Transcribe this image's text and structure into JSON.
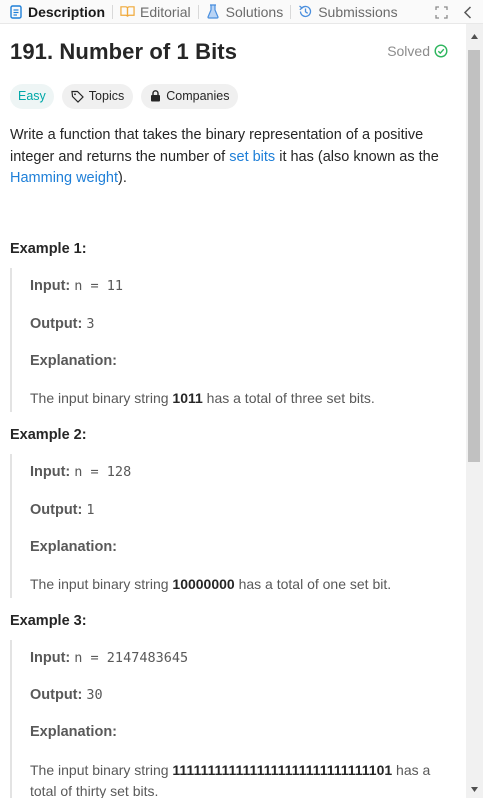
{
  "tabs": [
    {
      "label": "Description",
      "icon": "description-icon"
    },
    {
      "label": "Editorial",
      "icon": "book-icon"
    },
    {
      "label": "Solutions",
      "icon": "flask-icon"
    },
    {
      "label": "Submissions",
      "icon": "history-icon"
    }
  ],
  "problem": {
    "title": "191. Number of 1 Bits",
    "status": "Solved",
    "difficulty": "Easy",
    "topics_label": "Topics",
    "companies_label": "Companies",
    "desc_part1": "Write a function that takes the binary representation of a positive integer and returns the number of ",
    "desc_link1": "set bits",
    "desc_part2": " it has (also known as the ",
    "desc_link2": "Hamming weight",
    "desc_part3": ")."
  },
  "labels": {
    "input": "Input:",
    "output": "Output:",
    "explanation": "Explanation:"
  },
  "examples": [
    {
      "title": "Example 1:",
      "input": "n = 11",
      "output": "3",
      "exp_pre": "The input binary string ",
      "exp_bold": "1011",
      "exp_post": " has a total of three set bits."
    },
    {
      "title": "Example 2:",
      "input": "n = 128",
      "output": "1",
      "exp_pre": "The input binary string ",
      "exp_bold": "10000000",
      "exp_post": " has a total of one set bit."
    },
    {
      "title": "Example 3:",
      "input": "n = 2147483645",
      "output": "30",
      "exp_pre": "The input binary string ",
      "exp_bold": "1111111111111111111111111111101",
      "exp_post": " has a total of thirty set bits."
    }
  ],
  "colors": {
    "accent": "#1e7fd8",
    "easy": "#00a8a8",
    "solved_check": "#2db55d"
  }
}
